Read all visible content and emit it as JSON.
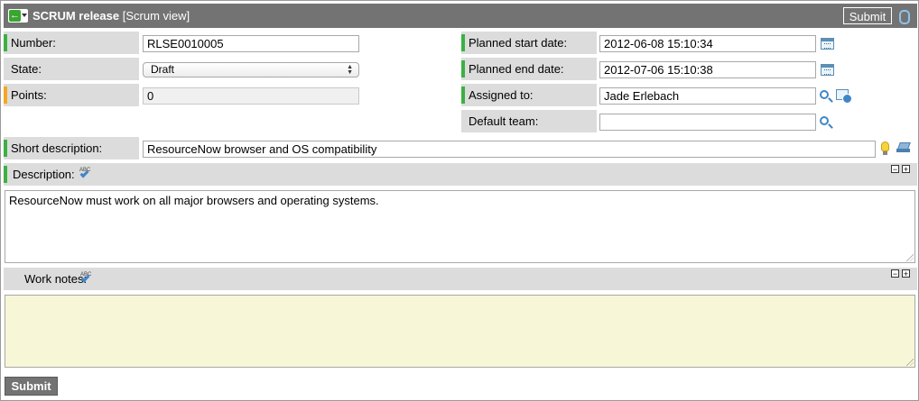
{
  "header": {
    "title": "SCRUM release",
    "view": "[Scrum view]",
    "submit_label": "Submit"
  },
  "left_fields": {
    "number": {
      "label": "Number:",
      "value": "RLSE0010005"
    },
    "state": {
      "label": "State:",
      "value": "Draft"
    },
    "points": {
      "label": "Points:",
      "value": "0"
    }
  },
  "right_fields": {
    "planned_start": {
      "label": "Planned start date:",
      "value": "2012-06-08 15:10:34"
    },
    "planned_end": {
      "label": "Planned end date:",
      "value": "2012-07-06 15:10:38"
    },
    "assigned_to": {
      "label": "Assigned to:",
      "value": "Jade Erlebach"
    },
    "default_team": {
      "label": "Default team:",
      "value": ""
    }
  },
  "short_description": {
    "label": "Short description:",
    "value": "ResourceNow browser and OS compatibility"
  },
  "description": {
    "label": "Description:",
    "value": "ResourceNow must work on all major browsers and operating systems."
  },
  "work_notes": {
    "label": "Work notes:",
    "value": ""
  },
  "spell_check_text": "ABC",
  "collapse_symbol": "−",
  "expand_symbol": "+",
  "back_symbol": "←",
  "footer": {
    "submit_label": "Submit"
  },
  "colors": {
    "header_bg": "#737373",
    "label_bg": "#dcdcdc",
    "mandatory": "#3cb043",
    "mandatory_warning": "#f5a623",
    "work_notes_bg": "#f7f7d7"
  },
  "icons": [
    "back-arrow-icon",
    "paperclip-icon",
    "calendar-icon",
    "search-icon",
    "user-lookup-icon",
    "lightbulb-icon",
    "stack-icon",
    "spell-check-icon",
    "collapse-icon",
    "expand-icon"
  ]
}
